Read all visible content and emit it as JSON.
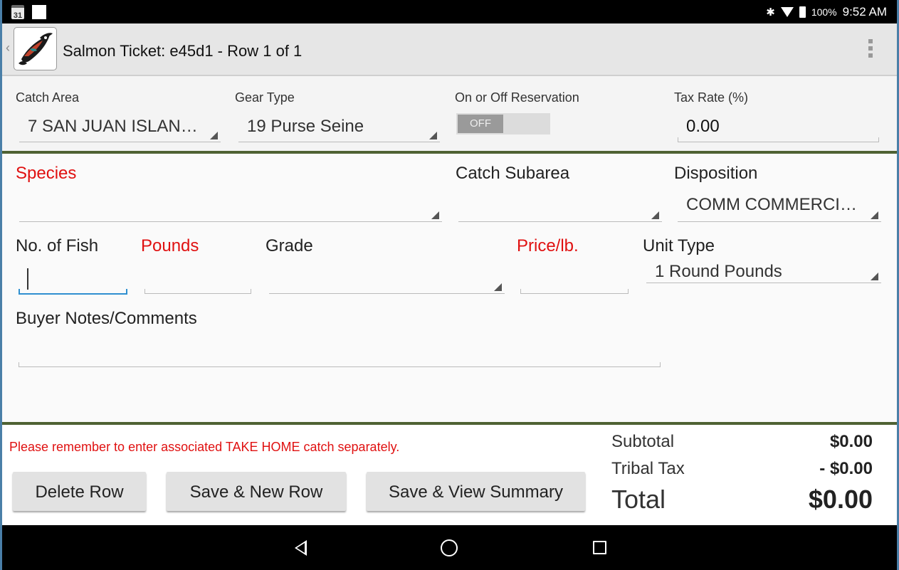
{
  "status_bar": {
    "calendar_day": "31",
    "battery_percent": "100%",
    "time": "9:52 AM"
  },
  "header": {
    "title": "Salmon Ticket: e45d1 - Row 1 of 1"
  },
  "top_fields": {
    "catch_area": {
      "label": "Catch Area",
      "value": "7  SAN JUAN ISLAN…"
    },
    "gear_type": {
      "label": "Gear Type",
      "value": "19 Purse Seine"
    },
    "reservation": {
      "label": "On or Off Reservation",
      "toggle_text": "OFF"
    },
    "tax_rate": {
      "label": "Tax Rate (%)",
      "value": "0.00"
    }
  },
  "detail_fields": {
    "species": {
      "label": "Species",
      "value": ""
    },
    "catch_subarea": {
      "label": "Catch Subarea",
      "value": ""
    },
    "disposition": {
      "label": "Disposition",
      "value": "COMM COMMERCI…"
    },
    "no_of_fish": {
      "label": "No. of Fish",
      "value": ""
    },
    "pounds": {
      "label": "Pounds",
      "value": ""
    },
    "grade": {
      "label": "Grade",
      "value": ""
    },
    "price_per_lb": {
      "label": "Price/lb.",
      "value": ""
    },
    "unit_type": {
      "label": "Unit Type",
      "value": "1 Round Pounds"
    },
    "buyer_notes": {
      "label": "Buyer Notes/Comments",
      "value": ""
    }
  },
  "footer": {
    "reminder": "Please remember to enter associated TAKE HOME catch separately.",
    "buttons": {
      "delete": "Delete Row",
      "save_new": "Save & New Row",
      "save_summary": "Save & View Summary"
    },
    "totals": {
      "subtotal_label": "Subtotal",
      "subtotal_value": "$0.00",
      "tax_label": "Tribal Tax",
      "tax_value": "- $0.00",
      "total_label": "Total",
      "total_value": "$0.00"
    }
  },
  "colors": {
    "required_label": "#e01111",
    "divider": "#4f6233",
    "focus_underline": "#2f8fd0"
  }
}
